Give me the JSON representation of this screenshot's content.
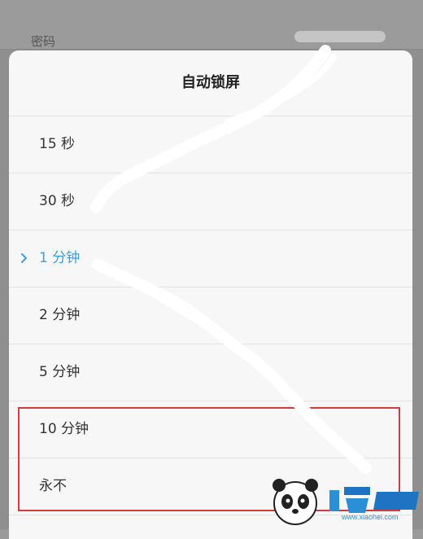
{
  "background": {
    "row_label": "密码"
  },
  "dialog": {
    "title": "自动锁屏",
    "options": [
      {
        "label": "15 秒",
        "selected": false
      },
      {
        "label": "30 秒",
        "selected": false
      },
      {
        "label": "1 分钟",
        "selected": true
      },
      {
        "label": "2 分钟",
        "selected": false
      },
      {
        "label": "5 分钟",
        "selected": false
      },
      {
        "label": "10 分钟",
        "selected": false
      },
      {
        "label": "永不",
        "selected": false
      }
    ]
  },
  "watermark": {
    "url": "www.xiaohei.com"
  },
  "colors": {
    "accent": "#3a9ee8",
    "highlight": "#d63b3b"
  },
  "icons": {
    "selected_marker": "chevron-right-icon"
  }
}
